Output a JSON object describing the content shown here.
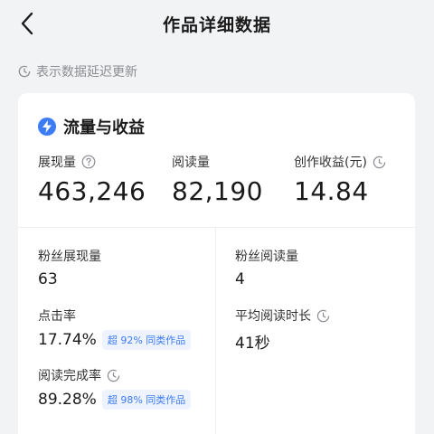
{
  "header": {
    "title": "作品详细数据"
  },
  "notice": {
    "text": "表示数据延迟更新"
  },
  "section": {
    "title": "流量与收益"
  },
  "top_metrics": [
    {
      "label": "展现量",
      "value": "463,246",
      "icon": "question-circle-icon"
    },
    {
      "label": "阅读量",
      "value": "82,190"
    },
    {
      "label": "创作收益(元)",
      "value": "14.84",
      "icon": "clock-icon"
    }
  ],
  "stats": {
    "fan_impressions": {
      "label": "粉丝展现量",
      "value": "63"
    },
    "fan_reads": {
      "label": "粉丝阅读量",
      "value": "4"
    },
    "ctr": {
      "label": "点击率",
      "value": "17.74%",
      "badge": "超 92% 同类作品"
    },
    "avg_read_time": {
      "label": "平均阅读时长",
      "value": "41秒",
      "icon": "clock-icon"
    },
    "completion_rate": {
      "label": "阅读完成率",
      "value": "89.28%",
      "badge": "超 98% 同类作品",
      "icon": "clock-icon"
    }
  },
  "colors": {
    "accent": "#3d7bf5",
    "badge_bg": "#edf3ff",
    "muted": "#8a8d93"
  }
}
